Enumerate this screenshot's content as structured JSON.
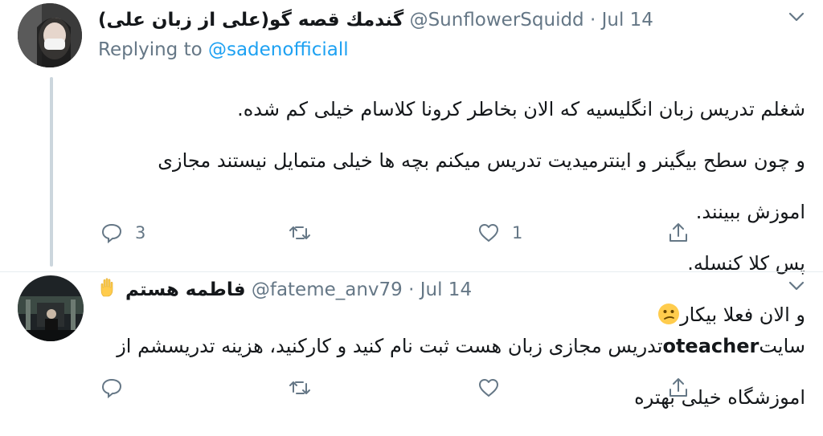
{
  "tweet1": {
    "display_name": "گندمك قصه گو(علی از زبان علی)",
    "handle": "@SunflowerSquidd",
    "separator": "·",
    "date": "Jul 14",
    "replying_prefix": "Replying to",
    "replying_to": "@sadenofficiall",
    "lines": [
      "شغلم تدریس زبان انگلیسیه که الان بخاطر کرونا کلاسام خیلی کم شده.",
      "و چون سطح بیگینر و اینترمیدیت تدریس میکنم بچه ها خیلی متمایل نیستند مجازی",
      "اموزش ببینند.",
      "پس کلا کنسله.",
      "و الان فعلا بیکار"
    ],
    "emoji": "confused-face",
    "reply_count": "3",
    "retweet_count": "",
    "like_count": "1"
  },
  "tweet2": {
    "display_name": "فاطمه هستم",
    "hand_emoji": "raised-hand",
    "handle": "@fateme_anv79",
    "separator": "·",
    "date": "Jul 14",
    "site_word": "سایت",
    "bold_word": "oteacher",
    "line1_rest": "تدریس مجازی زبان هست ثبت نام کنید و کارکنید، هزینه تدریسشم از",
    "line2": "اموزشگاه خیلی بهتره"
  },
  "colors": {
    "secondary_text": "#657786",
    "link": "#1da1f2",
    "divider": "#e6ecf0"
  }
}
